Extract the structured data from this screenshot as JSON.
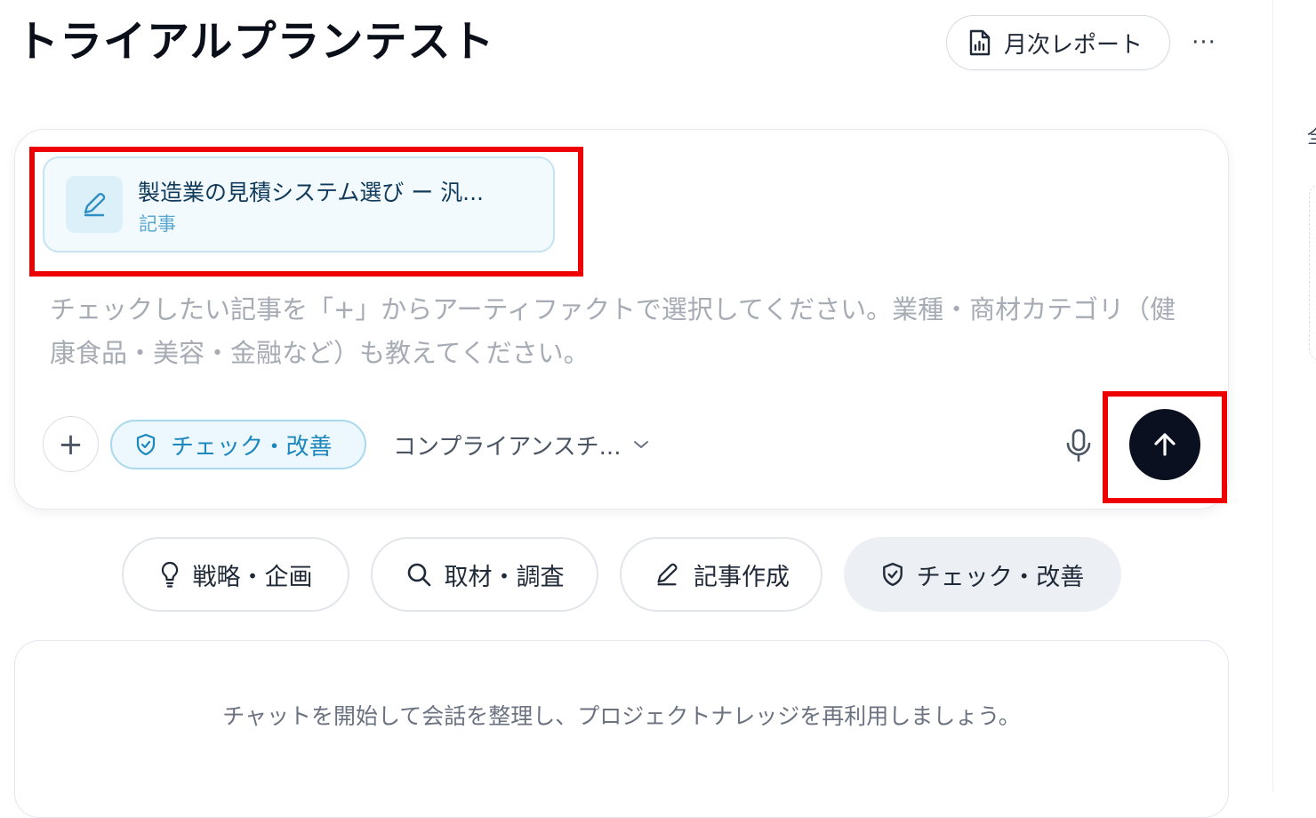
{
  "header": {
    "title": "トライアルプランテスト",
    "report_button_label": "月次レポート",
    "report_icon": "file-chart-icon",
    "more_label": "···"
  },
  "right_panel": {
    "peek_text": "全"
  },
  "composer": {
    "artifact": {
      "title": "製造業の見積システム選び ー 汎...",
      "type": "記事",
      "icon": "pencil-icon"
    },
    "placeholder": "チェックしたい記事を「+」からアーティファクトで選択してください。業種・商材カテゴリ（健康食品・美容・金融など）も教えてください。",
    "add_label": "+",
    "mode_chip_label": "チェック・改善",
    "mode_chip_icon": "shield-check-icon",
    "compliance_select_label": "コンプライアンスチ...",
    "mic_icon": "microphone-icon",
    "send_icon": "arrow-up-icon"
  },
  "modes": [
    {
      "label": "戦略・企画",
      "icon": "lightbulb-icon",
      "active": false
    },
    {
      "label": "取材・調査",
      "icon": "search-icon",
      "active": false
    },
    {
      "label": "記事作成",
      "icon": "pencil-icon",
      "active": false
    },
    {
      "label": "チェック・改善",
      "icon": "shield-check-icon",
      "active": true
    }
  ],
  "empty_chat": {
    "message": "チャットを開始して会話を整理し、プロジェクトナレッジを再利用しましょう。"
  },
  "colors": {
    "highlight": "#ef0000",
    "accent": "#1b87bd",
    "send_button": "#0b1020"
  }
}
